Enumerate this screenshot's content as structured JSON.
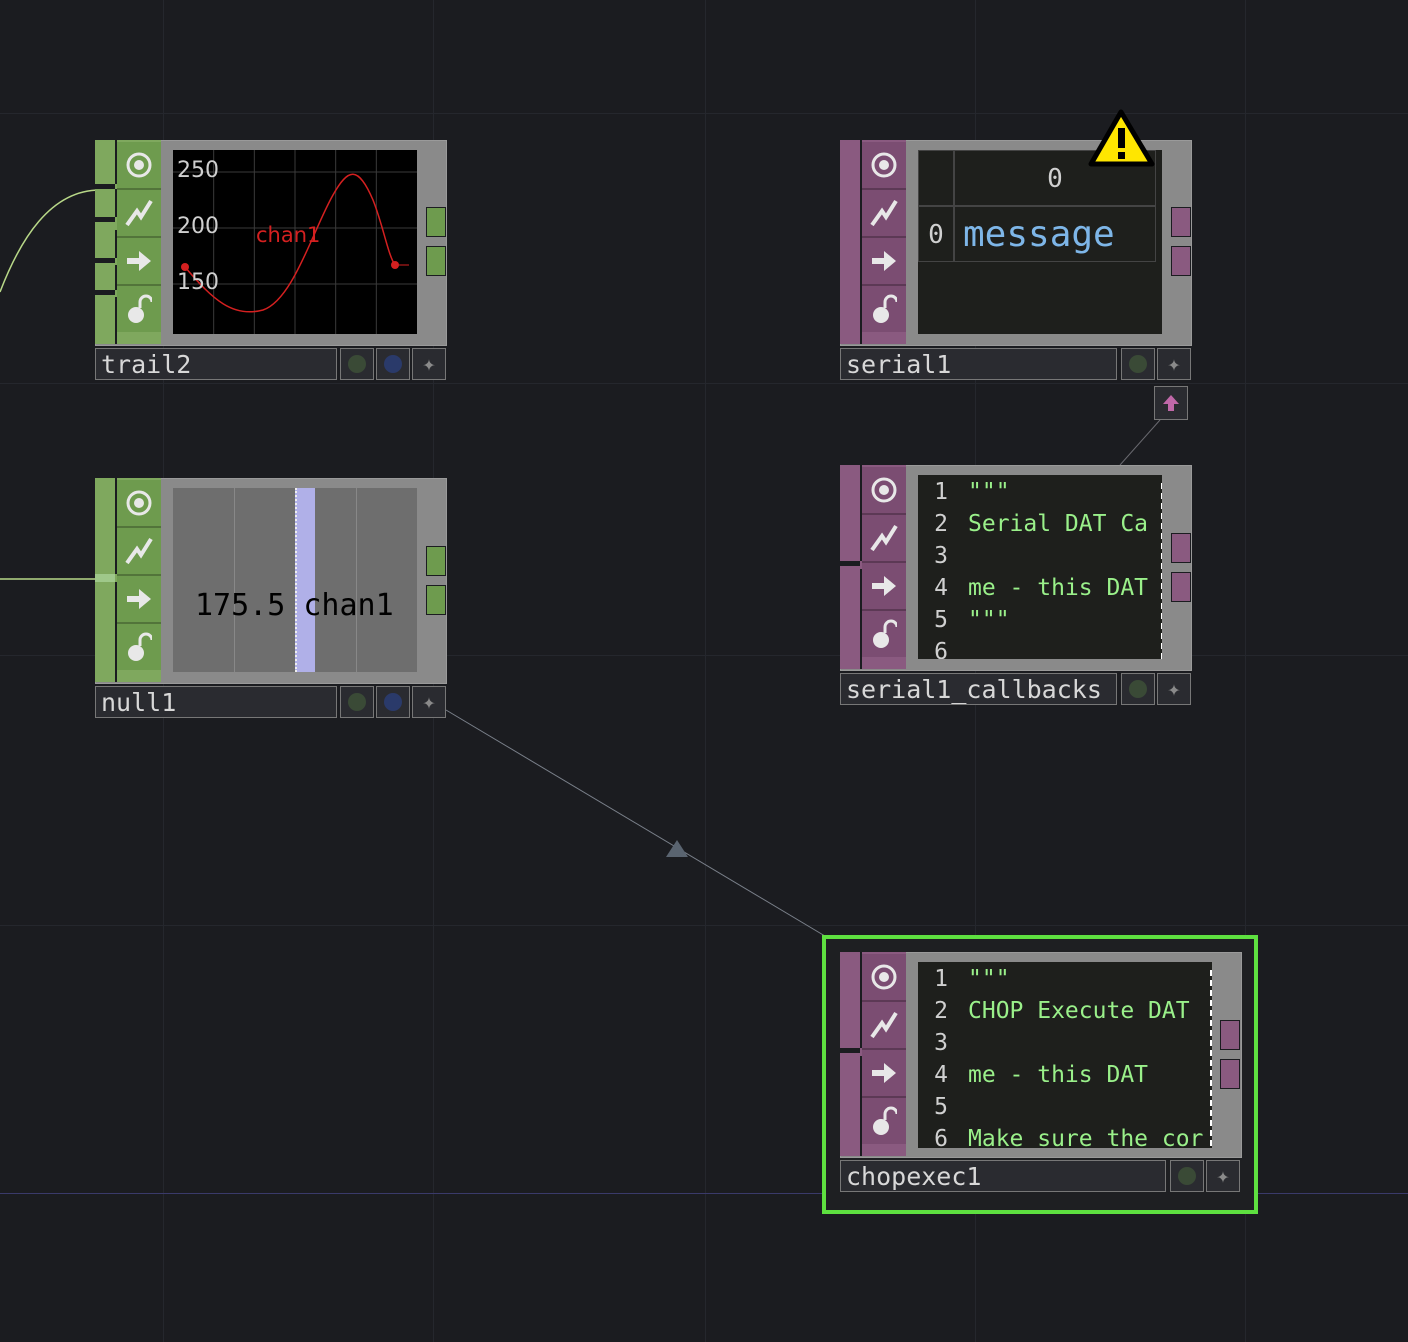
{
  "colors": {
    "background": "#1b1c20",
    "chop_family": "#7fa85e",
    "dat_family": "#8a5a80",
    "selection": "#5ee040",
    "code_text": "#9af08a",
    "graph_curve": "#d42020",
    "warning": "#ffe600"
  },
  "nodes": {
    "trail2": {
      "name": "trail2",
      "family": "CHOP",
      "viewer": {
        "y_ticks": [
          "250",
          "200",
          "150"
        ],
        "channel_label": "chan1"
      }
    },
    "null1": {
      "name": "null1",
      "family": "CHOP",
      "viewer": {
        "value": "175.5",
        "channel_label": "chan1"
      }
    },
    "serial1": {
      "name": "serial1",
      "family": "DAT",
      "warning_icon": "warning-triangle-icon",
      "table": {
        "col_header": "0",
        "row_header": "0",
        "cell": "message"
      }
    },
    "serial1_callbacks": {
      "name": "serial1_callbacks",
      "family": "DAT",
      "lines": [
        {
          "num": "1",
          "text": "\"\"\""
        },
        {
          "num": "2",
          "text": "Serial DAT Ca"
        },
        {
          "num": "3",
          "text": ""
        },
        {
          "num": "4",
          "text": "me - this DAT"
        },
        {
          "num": "5",
          "text": "\"\"\""
        },
        {
          "num": "6",
          "text": ""
        }
      ]
    },
    "chopexec1": {
      "name": "chopexec1",
      "family": "DAT",
      "selected": true,
      "lines": [
        {
          "num": "1",
          "text": "\"\"\""
        },
        {
          "num": "2",
          "text": "CHOP Execute DAT"
        },
        {
          "num": "3",
          "text": ""
        },
        {
          "num": "4",
          "text": "me - this DAT"
        },
        {
          "num": "5",
          "text": ""
        },
        {
          "num": "6",
          "text": "Make sure the cor"
        }
      ]
    }
  },
  "icons": {
    "viewer_toggle": "target-icon",
    "cook": "lightning-icon",
    "bypass": "arrow-right-icon",
    "lock": "lock-icon",
    "docked": "arrow-up-icon"
  }
}
